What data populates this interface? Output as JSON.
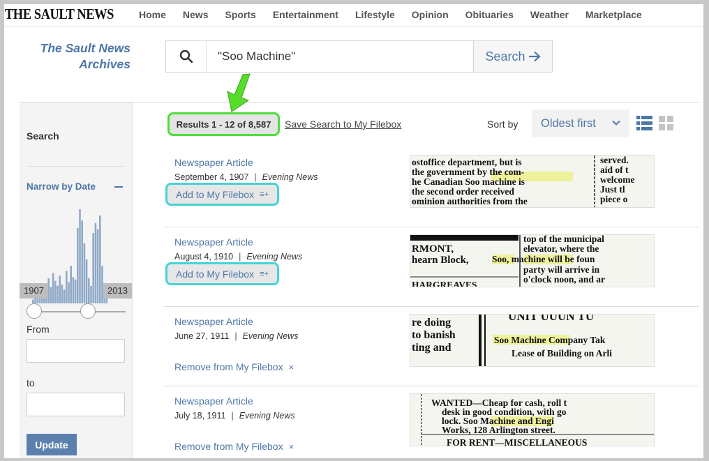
{
  "site": {
    "logo": "THE SAULT NEWS"
  },
  "nav": [
    "Home",
    "News",
    "Sports",
    "Entertainment",
    "Lifestyle",
    "Opinion",
    "Obituaries",
    "Weather",
    "Marketplace"
  ],
  "archives": {
    "line1": "The Sault News",
    "line2": "Archives"
  },
  "search": {
    "value": "\"Soo Machine\"",
    "button_label": "Search",
    "icon": "search-icon"
  },
  "sidebar": {
    "heading": "Search",
    "narrow_label": "Narrow by Date",
    "range_start": "1907",
    "range_end": "2013",
    "from_label": "From",
    "to_label": "to",
    "update_label": "Update"
  },
  "results": {
    "summary": "Results 1 - 12 of 8,587",
    "save_search": "Save Search to My Filebox",
    "sort_label": "Sort by",
    "sort_value": "Oldest first"
  },
  "items": [
    {
      "type": "Newspaper Article",
      "date": "September 4, 1907",
      "publication": "Evening News",
      "action": "Add to My Filebox",
      "action_icon": "≡+",
      "snippet": [
        "ostoffice department, but is",
        "the government by the com-",
        "he Canadian Soo machine is",
        "the second order received",
        "ominion authorities from the"
      ],
      "snippet_right": [
        "served.",
        "aid of t",
        "welcome",
        "Just tl",
        "piece o"
      ]
    },
    {
      "type": "Newspaper Article",
      "date": "August 4, 1910",
      "publication": "Evening News",
      "action": "Add to My Filebox",
      "action_icon": "≡+",
      "snippet": [
        "RMONT,",
        "hearn Block,",
        "HARGREAVES"
      ],
      "snippet_right": [
        "top of the municipal",
        "elevator, where the",
        "Soo, machine will be foun",
        "party will arrive in",
        "o'clock noon, and ar"
      ]
    },
    {
      "type": "Newspaper Article",
      "date": "June 27, 1911",
      "publication": "Evening News",
      "action": "Remove from My Filebox",
      "action_icon": "×",
      "snippet": [
        "re doing",
        "to banish",
        "ting and"
      ],
      "snippet_right": [
        "UNIT UUUN TU",
        "Soo Machine Company Tak",
        "Lease of Building on Arli"
      ]
    },
    {
      "type": "Newspaper Article",
      "date": "July 18, 1911",
      "publication": "Evening News",
      "action": "Remove from My Filebox",
      "action_icon": "×",
      "snippet": [
        "WANTED—Cheap for cash, roll t",
        "desk in good condition, with go",
        "lock. Soo Machine and Engi",
        "Works, 128 Arlington street.",
        "FOR RENT—MISCELLANEOUS"
      ],
      "snippet_right": []
    }
  ],
  "colors": {
    "accent": "#4d77a8",
    "highlight_green": "#4fdd3d",
    "highlight_cyan": "#45d4d6",
    "arrow": "#56dd2c"
  }
}
